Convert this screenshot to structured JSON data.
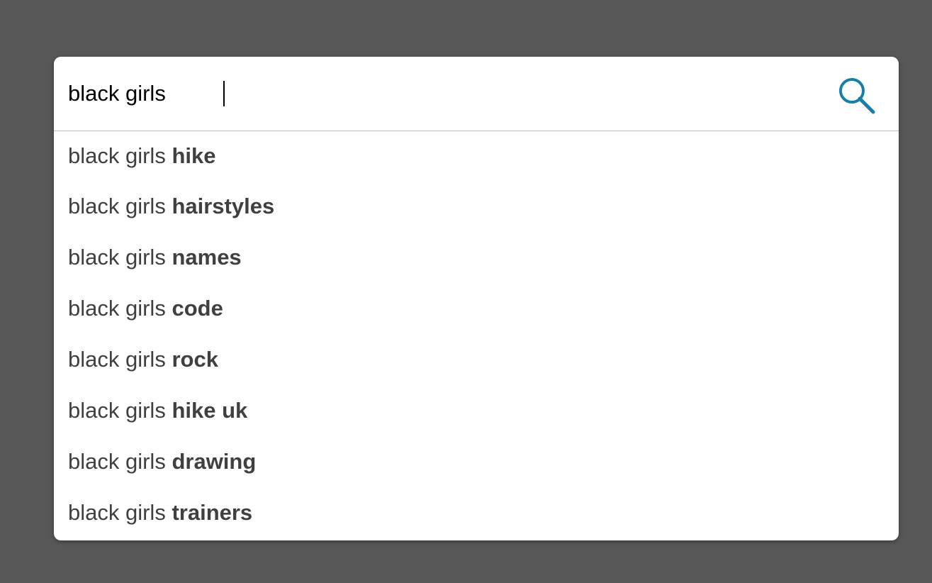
{
  "search": {
    "query": "black girls",
    "icon": "search-icon",
    "icon_color": "#1a7fa8"
  },
  "suggestions": [
    {
      "prefix": "black girls",
      "completion": "hike"
    },
    {
      "prefix": "black girls",
      "completion": "hairstyles"
    },
    {
      "prefix": "black girls",
      "completion": "names"
    },
    {
      "prefix": "black girls",
      "completion": "code"
    },
    {
      "prefix": "black girls",
      "completion": "rock"
    },
    {
      "prefix": "black girls",
      "completion": "hike uk"
    },
    {
      "prefix": "black girls",
      "completion": "drawing"
    },
    {
      "prefix": "black girls",
      "completion": "trainers"
    }
  ],
  "colors": {
    "backdrop": "#575757",
    "panel": "#ffffff",
    "suggestion_text": "#404040",
    "divider": "#bdbdbd"
  }
}
